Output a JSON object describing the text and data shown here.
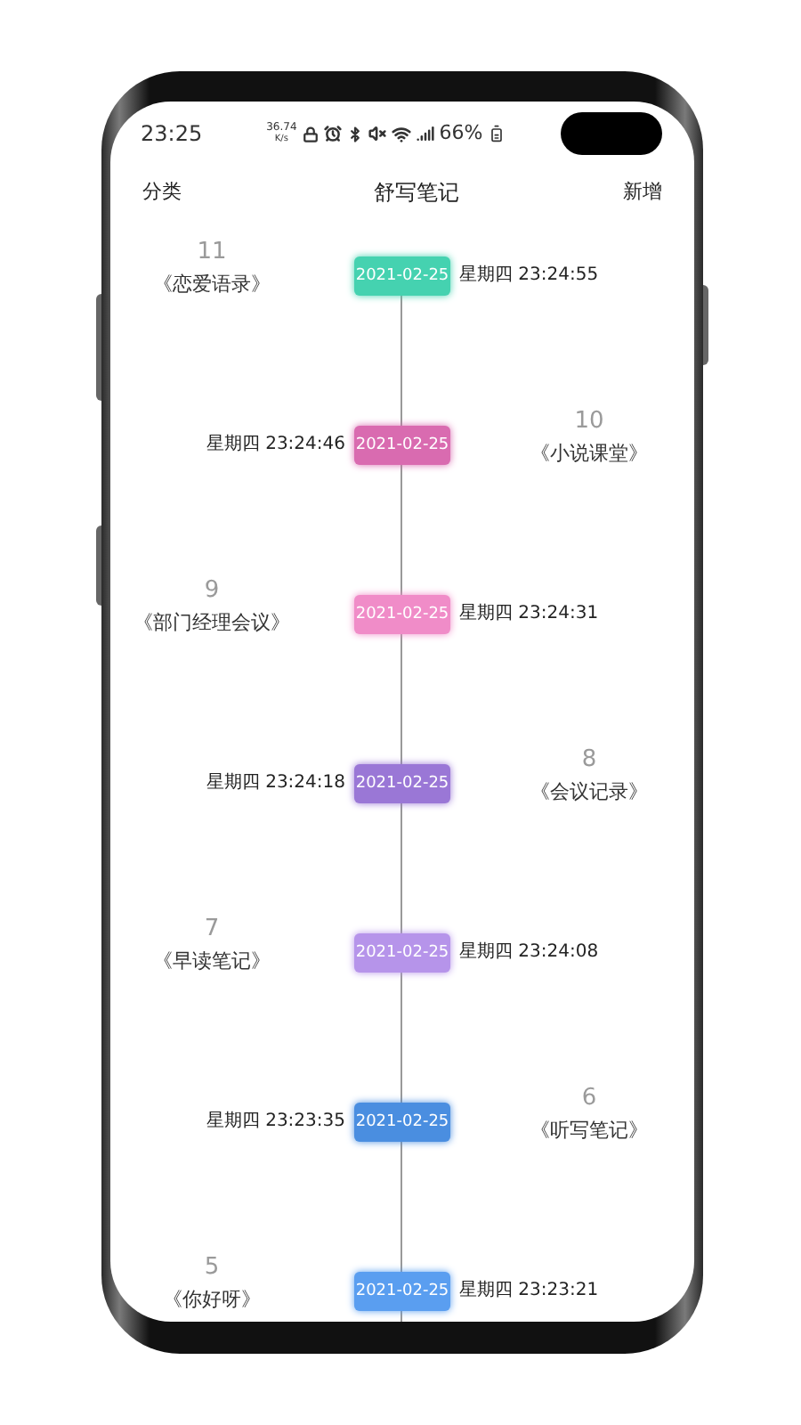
{
  "status_bar": {
    "time": "23:25",
    "net_speed": "36.74",
    "net_unit": "K/s",
    "battery": "66%"
  },
  "header": {
    "left": "分类",
    "title": "舒写笔记",
    "right": "新增"
  },
  "timeline": [
    {
      "number": "11",
      "title": "《恋爱语录》",
      "date": "2021-02-25",
      "time": "星期四 23:24:55",
      "color": "#45d2b0"
    },
    {
      "number": "10",
      "title": "《小说课堂》",
      "date": "2021-02-25",
      "time": "星期四 23:24:46",
      "color": "#d96bb0"
    },
    {
      "number": "9",
      "title": "《部门经理会议》",
      "date": "2021-02-25",
      "time": "星期四 23:24:31",
      "color": "#f08cc8"
    },
    {
      "number": "8",
      "title": "《会议记录》",
      "date": "2021-02-25",
      "time": "星期四 23:24:18",
      "color": "#9a77d6"
    },
    {
      "number": "7",
      "title": "《早读笔记》",
      "date": "2021-02-25",
      "time": "星期四 23:24:08",
      "color": "#b694ea"
    },
    {
      "number": "6",
      "title": "《听写笔记》",
      "date": "2021-02-25",
      "time": "星期四 23:23:35",
      "color": "#4a8ee0"
    },
    {
      "number": "5",
      "title": "《你好呀》",
      "date": "2021-02-25",
      "time": "星期四 23:23:21",
      "color": "#5a9ef0"
    }
  ]
}
